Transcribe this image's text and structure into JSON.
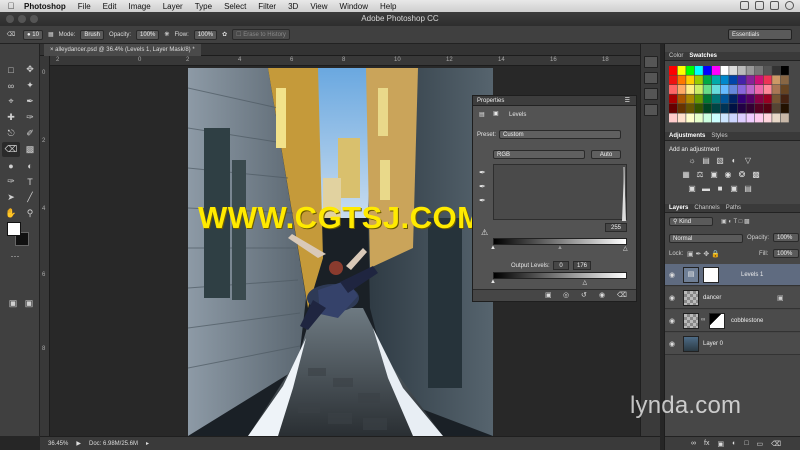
{
  "menubar": {
    "app": "Photoshop",
    "items": [
      "File",
      "Edit",
      "Image",
      "Layer",
      "Type",
      "Select",
      "Filter",
      "3D",
      "View",
      "Window",
      "Help"
    ]
  },
  "window": {
    "title": "Adobe Photoshop CC"
  },
  "options": {
    "brush_size": "10",
    "mode_label": "Mode:",
    "mode_value": "Brush",
    "opacity_label": "Opacity:",
    "opacity_value": "100%",
    "flow_label": "Flow:",
    "flow_value": "100%",
    "erase_history": "Erase to History",
    "workspace": "Essentials"
  },
  "document": {
    "tab": "alleydancer.psd @ 36.4% (Levels 1, Layer Mask/8) *",
    "zoom": "36.45%",
    "doc_size": "Doc: 6.98M/25.6M",
    "ruler_h": [
      "2",
      "0",
      "2",
      "4",
      "6",
      "8",
      "10",
      "12",
      "14",
      "16",
      "18",
      "20"
    ],
    "ruler_v": [
      "0",
      "2",
      "4",
      "6",
      "8"
    ]
  },
  "watermark": "WWW.CGTSJ.COM",
  "brand": "lynda.com",
  "properties": {
    "tab": "Properties",
    "adj_name": "Levels",
    "preset_label": "Preset:",
    "preset_value": "Custom",
    "channel": "RGB",
    "auto": "Auto",
    "input_max": "255",
    "output_label": "Output Levels:",
    "output_min": "0",
    "output_max": "176",
    "output_level_fraction": 0.69
  },
  "panels": {
    "swatch_tabs": [
      "Color",
      "Swatches"
    ],
    "adj_tabs": [
      "Adjustments",
      "Styles"
    ],
    "adj_title": "Add an adjustment",
    "layer_tabs": [
      "Layers",
      "Channels",
      "Paths"
    ],
    "kind": "Kind",
    "blend": "Normal",
    "opacity_label": "Opacity:",
    "opacity": "100%",
    "lock_label": "Lock:",
    "fill_label": "Fill:",
    "fill": "100%",
    "layers": [
      {
        "name": "Levels 1",
        "selected": true
      },
      {
        "name": "dancer",
        "selected": false
      },
      {
        "name": "cobblestone",
        "selected": false
      },
      {
        "name": "Layer 0",
        "selected": false
      }
    ]
  },
  "colors": {
    "watermark": "#ffea00",
    "selected_layer": "#5f6b80"
  },
  "swatch_colors": [
    "#ff0000",
    "#ffff00",
    "#00ff00",
    "#00ffff",
    "#0000ff",
    "#ff00ff",
    "#ffffff",
    "#dddddd",
    "#bbbbbb",
    "#999999",
    "#777777",
    "#555555",
    "#333333",
    "#000000",
    "#ee1111",
    "#ff7700",
    "#ffcc00",
    "#99cc00",
    "#00aa44",
    "#00aaaa",
    "#0088cc",
    "#0044aa",
    "#4422aa",
    "#882299",
    "#cc1177",
    "#ee3355",
    "#cc9966",
    "#886644",
    "#ff6666",
    "#ffaa66",
    "#ffee88",
    "#ccee66",
    "#66dd88",
    "#66dddd",
    "#66bbff",
    "#6688dd",
    "#8866dd",
    "#bb66cc",
    "#ee66aa",
    "#ff8899",
    "#aa7755",
    "#664422",
    "#aa0000",
    "#aa5500",
    "#aa8800",
    "#669900",
    "#007733",
    "#007777",
    "#005599",
    "#002266",
    "#330077",
    "#550066",
    "#880044",
    "#990022",
    "#775533",
    "#442211",
    "#660000",
    "#663300",
    "#665500",
    "#335500",
    "#004422",
    "#004444",
    "#003355",
    "#001144",
    "#220044",
    "#330033",
    "#550022",
    "#550011",
    "#554433",
    "#221100",
    "#ffcccc",
    "#ffe0cc",
    "#ffffcc",
    "#e6ffcc",
    "#ccffe0",
    "#ccffff",
    "#cce6ff",
    "#ccd5ff",
    "#ddccff",
    "#f0ccff",
    "#ffccee",
    "#ffd6dd",
    "#e8d8c8",
    "#c8b8a8"
  ]
}
